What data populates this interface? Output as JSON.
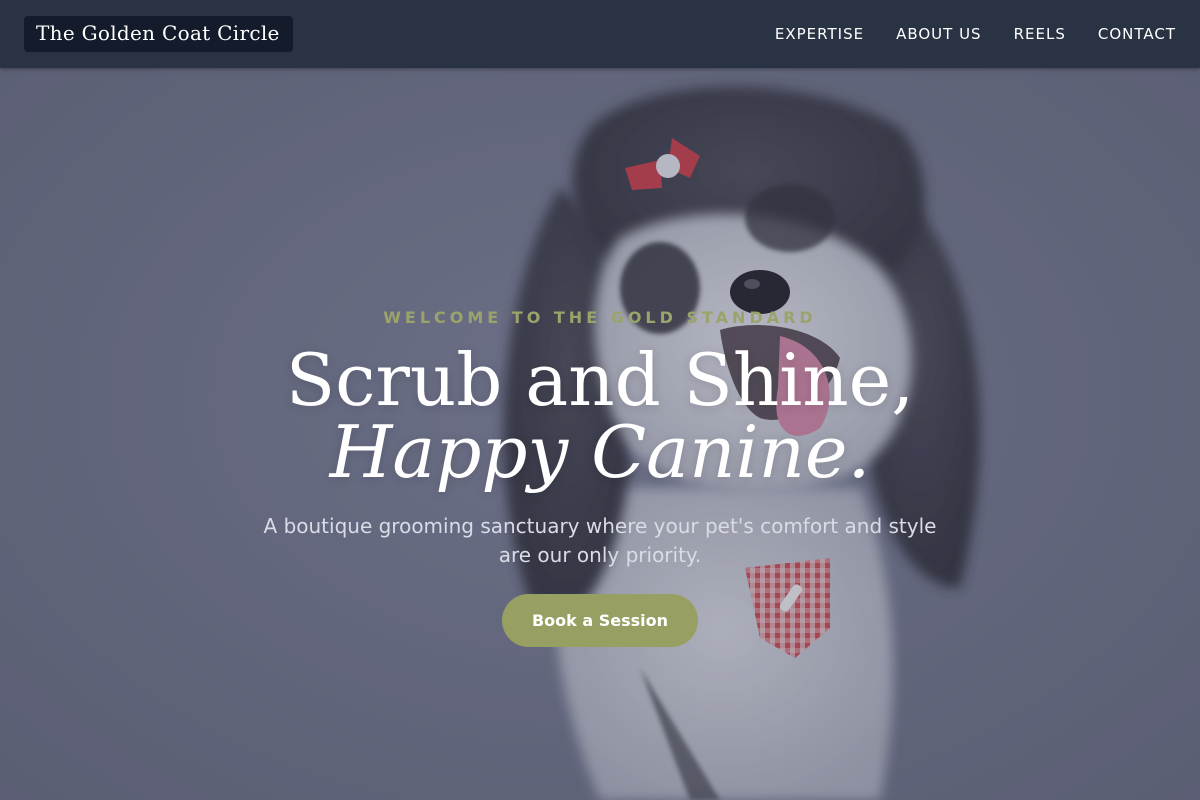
{
  "brand": {
    "name": "The Golden Coat Circle"
  },
  "nav": {
    "items": [
      {
        "label": "EXPERTISE"
      },
      {
        "label": "ABOUT US"
      },
      {
        "label": "REELS"
      },
      {
        "label": "CONTACT"
      }
    ]
  },
  "hero": {
    "eyebrow": "WELCOME TO THE GOLD STANDARD",
    "headline_line1": "Scrub and Shine,",
    "headline_line2": "Happy Canine.",
    "subtitle": "A boutique grooming sanctuary where your pet's comfort and style are our only priority.",
    "cta_label": "Book a Session",
    "background_image": "shaggy-dog-with-red-bow-and-bandana-photo"
  },
  "colors": {
    "header_bg": "#2a3344",
    "brand_bg": "#141b2b",
    "accent_olive": "#97a062",
    "eyebrow_olive": "#9aa46a",
    "hero_overlay": "#3e425c"
  }
}
